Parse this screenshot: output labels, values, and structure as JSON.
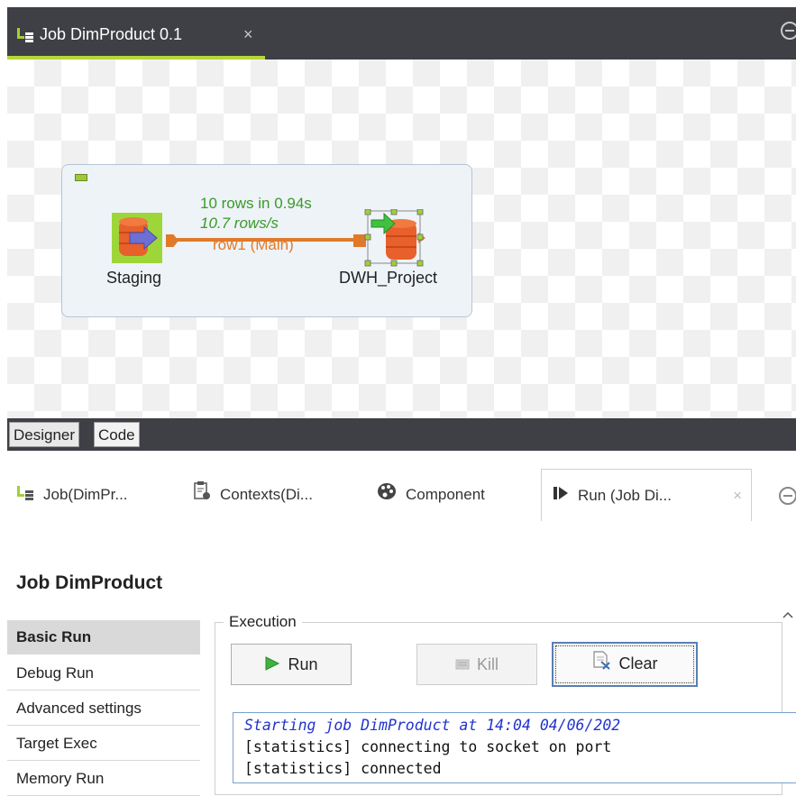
{
  "editor": {
    "tab_label": "Job DimProduct 0.1",
    "tab_close": "×",
    "tab_underline_color": "#b5d63a"
  },
  "canvas": {
    "components": [
      {
        "label": "Staging",
        "icon": "database-input-icon"
      },
      {
        "label": "DWH_Project",
        "icon": "database-output-icon"
      }
    ],
    "connection": {
      "stats_rows": "10 rows in 0.94s",
      "stats_rate": "10.7 rows/s",
      "label": "row1 (Main)"
    },
    "colors": {
      "stats": "#3a9b27",
      "connection": "#e07a2a",
      "database": "#e8602c"
    }
  },
  "designer_tabs": [
    "Designer",
    "Code"
  ],
  "views": {
    "tabs": [
      {
        "label": "Job(DimPr...",
        "icon": "job-icon"
      },
      {
        "label": "Contexts(Di...",
        "icon": "contexts-icon"
      },
      {
        "label": "Component",
        "icon": "palette-icon"
      },
      {
        "label": "Run (Job Di...",
        "icon": "run-view-icon"
      }
    ],
    "active_close": "×"
  },
  "run": {
    "title": "Job DimProduct",
    "nav": [
      "Basic Run",
      "Debug Run",
      "Advanced settings",
      "Target Exec",
      "Memory Run"
    ],
    "active_nav": "Basic Run",
    "execution_legend": "Execution",
    "buttons": {
      "run": "Run",
      "kill": "Kill",
      "clear": "Clear"
    },
    "console": [
      "Starting job DimProduct at 14:04 04/06/202",
      "[statistics] connecting to socket on port",
      "[statistics] connected"
    ]
  }
}
